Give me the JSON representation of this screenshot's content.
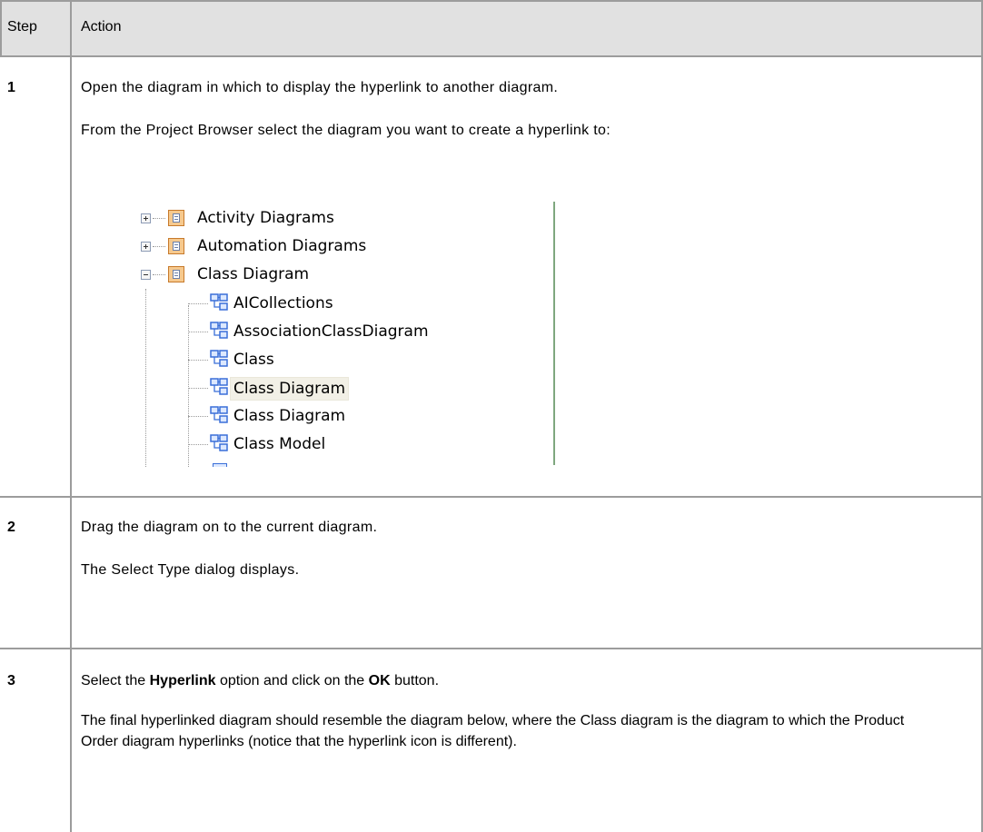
{
  "table": {
    "headers": {
      "step": "Step",
      "action": "Action"
    },
    "rows": [
      {
        "step": "1",
        "lines": [
          "Open the diagram in which to display the hyperlink to another diagram.",
          "From the Project Browser select the diagram you want to create a hyperlink to:"
        ]
      },
      {
        "step": "2",
        "lines": [
          "Drag the diagram on to the current diagram.",
          "The Select Type dialog displays."
        ]
      },
      {
        "step": "3",
        "line1": {
          "pre": "Select the ",
          "bold1": "Hyperlink",
          "mid": " option and click on the ",
          "bold2": "OK",
          "post": " button."
        },
        "para": "The final hyperlinked diagram should resemble the diagram below, where the Class diagram is the diagram to which the Product Order diagram hyperlinks (notice that the hyperlink icon is different)."
      }
    ]
  },
  "tree": {
    "packages": [
      {
        "label": "Activity Diagrams",
        "expanded": false,
        "icon": "package-icon"
      },
      {
        "label": "Automation Diagrams",
        "expanded": false,
        "icon": "package-icon"
      },
      {
        "label": "Class Diagram",
        "expanded": true,
        "icon": "package-icon"
      }
    ],
    "children": [
      {
        "label": "AICollections",
        "icon": "class-diagram-icon"
      },
      {
        "label": "AssociationClassDiagram",
        "icon": "class-diagram-icon"
      },
      {
        "label": "Class",
        "icon": "class-diagram-icon"
      },
      {
        "label": "Class Diagram",
        "icon": "class-diagram-icon",
        "selected": true
      },
      {
        "label": "Class Diagram",
        "icon": "class-diagram-icon"
      },
      {
        "label": "Class Model",
        "icon": "class-diagram-icon"
      }
    ]
  },
  "colors": {
    "header_bg": "#e1e1e1",
    "border": "#9c9c9c",
    "selection": "#f2f0e6",
    "package_fill": "#f6c98e",
    "diagram_icon": "#3a6fd8"
  }
}
